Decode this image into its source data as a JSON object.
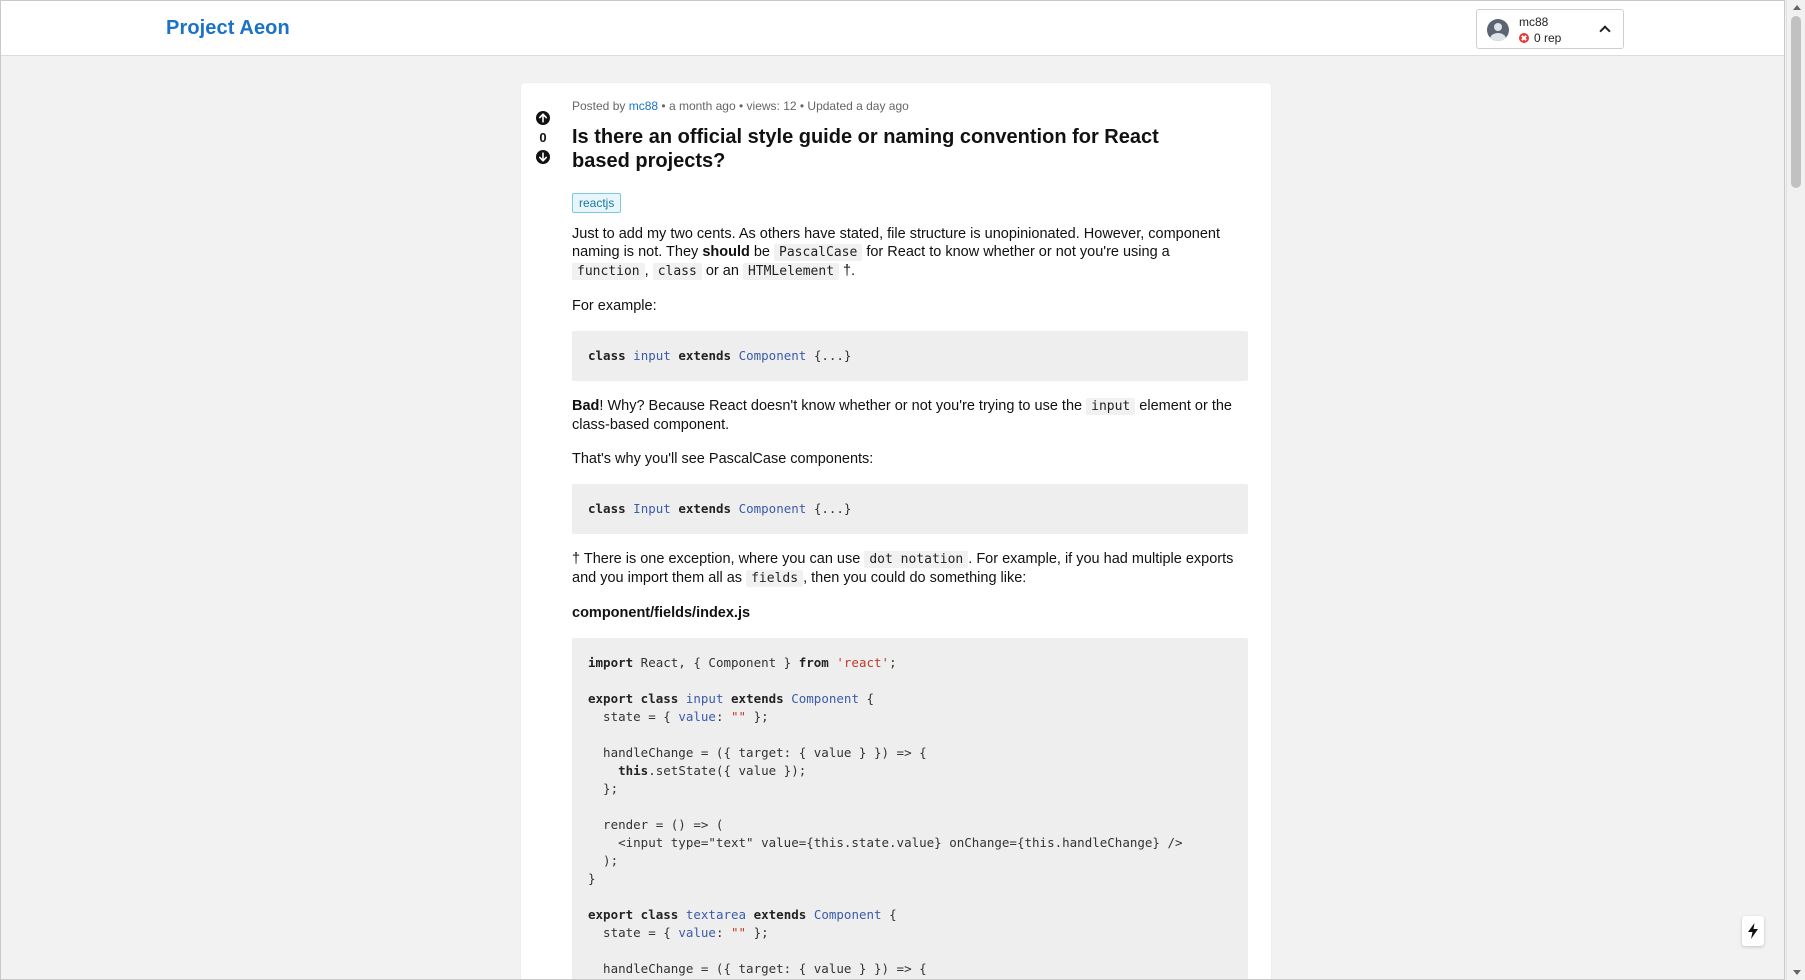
{
  "header": {
    "brand": "Project Aeon",
    "user": {
      "name": "mc88",
      "rep": "0 rep",
      "icons": [
        "avatar-icon",
        "rep-x-icon",
        "chevron-up-icon"
      ]
    }
  },
  "post": {
    "meta": {
      "posted_by_label": "Posted by",
      "author": "mc88",
      "rest": "• a month ago • views: 12 • Updated a day ago"
    },
    "votes": "0",
    "title": "Is there an official style guide or naming convention for React based projects?",
    "tag": "reactjs",
    "p1": {
      "t1": "Just to add my two cents. As others have stated, file structure is unopinionated. However, component naming is not. They ",
      "strong": "should",
      "t2": " be ",
      "c1": "PascalCase",
      "t3": " for React to know whether or not you're using a ",
      "c2": "function",
      "t4": ", ",
      "c3": "class",
      "t5": " or an ",
      "c4": "HTMLelement",
      "t6": " †."
    },
    "p2": "For example:",
    "code1": {
      "kw1": "class",
      "name": "input",
      "kw2": "extends",
      "base": "Component",
      "rest": "{...}"
    },
    "p3": {
      "strong": "Bad",
      "t1": "! Why? Because React doesn't know whether or not you're trying to use the ",
      "c1": "input",
      "t2": " element or the class-based component."
    },
    "p4": "That's why you'll see PascalCase components:",
    "code2": {
      "kw1": "class",
      "name": "Input",
      "kw2": "extends",
      "base": "Component",
      "rest": "{...}"
    },
    "p5": {
      "t1": "† There is one exception, where you can use ",
      "c1": "dot notation",
      "t2": ". For example, if you had multiple exports and you import them all as ",
      "c2": "fields",
      "t3": ", then you could do something like:"
    },
    "filename": "component/fields/index.js",
    "code3": {
      "l1_kw": "import",
      "l1_mid": " React, { Component } ",
      "l1_kw2": "from",
      "l1_str": "'react'",
      "l1_end": ";",
      "l3_kw": "export class",
      "l3_name": "input",
      "l3_kw2": "extends",
      "l3_base": "Component",
      "l3_end": " {",
      "l4_a": "  state = { ",
      "l4_key": "value",
      "l4_b": ": ",
      "l4_str": "\"\"",
      "l4_c": " };",
      "l6": "  handleChange = ({ target: { value } }) => {",
      "l7_kw": "this",
      "l7_rest": ".setState({ value });",
      "l8": "  };",
      "l10": "  render = () => (",
      "l11": "    <input type=\"text\" value={this.state.value} onChange={this.handleChange} />",
      "l12": "  );",
      "l13": "}",
      "l15_kw": "export class",
      "l15_name": "textarea",
      "l15_kw2": "extends",
      "l15_base": "Component",
      "l15_end": " {",
      "l16_a": "  state = { ",
      "l16_key": "value",
      "l16_b": ": ",
      "l16_str": "\"\"",
      "l16_c": " };",
      "l18": "  handleChange = ({ target: { value } }) => {"
    }
  },
  "icons": [
    "upvote-icon",
    "downvote-icon",
    "lightning-icon"
  ]
}
